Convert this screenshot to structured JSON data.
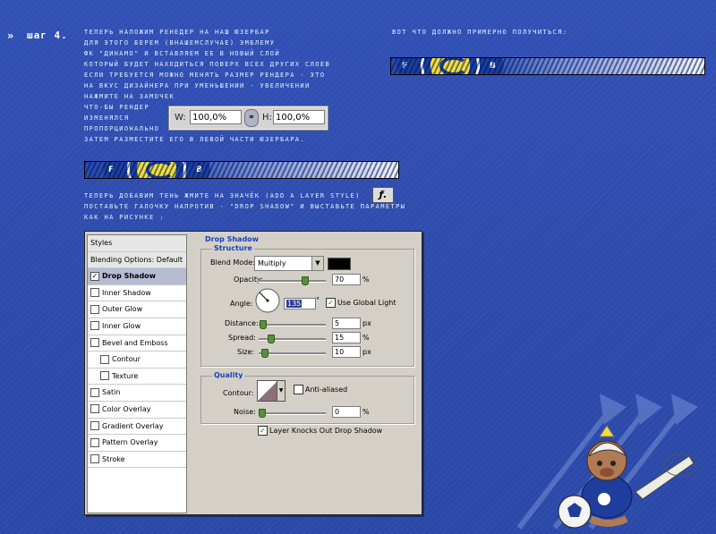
{
  "step": {
    "arrows": "»",
    "label": "шаг 4."
  },
  "text_block_1": [
    "теперь наложим ренедер на наш юзербар",
    "для этого берем (внашемслучае) эмблему",
    "фк \"динамо\" и вставляем ее в новый слой",
    "который будет находиться поверх всех других слоев",
    "если требуется можно менять размер рендера - это",
    "на вкус дизайнера при уменьшении - увеличении",
    "нажмите на замочек",
    "что-бы рендер",
    "изменялся",
    "пропорционально",
    "затем разместите его в левой части юзербара."
  ],
  "text_right": "вот что должно примерно получиться:",
  "size_panel": {
    "w_label": "W:",
    "w_value": "100,0%",
    "h_label": "H:",
    "h_value": "100,0%"
  },
  "text_block_2": [
    "теперь добавим тень жмите на значёк (add a layer style)",
    "поставьте галочку напротив - \"drop shadow\" и выставьте параметры",
    "как на рисунке :"
  ],
  "add_style_icon": "ƒ.",
  "banner_letters": {
    "left": "F",
    "right": "B"
  },
  "dialog": {
    "styles_header": "Styles",
    "blending_options": "Blending Options: Default",
    "styles": [
      {
        "label": "Drop Shadow",
        "checked": true,
        "selected": true,
        "indent": false
      },
      {
        "label": "Inner Shadow",
        "checked": false,
        "selected": false,
        "indent": false
      },
      {
        "label": "Outer Glow",
        "checked": false,
        "selected": false,
        "indent": false
      },
      {
        "label": "Inner Glow",
        "checked": false,
        "selected": false,
        "indent": false
      },
      {
        "label": "Bevel and Emboss",
        "checked": false,
        "selected": false,
        "indent": false
      },
      {
        "label": "Contour",
        "checked": false,
        "selected": false,
        "indent": true
      },
      {
        "label": "Texture",
        "checked": false,
        "selected": false,
        "indent": true
      },
      {
        "label": "Satin",
        "checked": false,
        "selected": false,
        "indent": false
      },
      {
        "label": "Color Overlay",
        "checked": false,
        "selected": false,
        "indent": false
      },
      {
        "label": "Gradient Overlay",
        "checked": false,
        "selected": false,
        "indent": false
      },
      {
        "label": "Pattern Overlay",
        "checked": false,
        "selected": false,
        "indent": false
      },
      {
        "label": "Stroke",
        "checked": false,
        "selected": false,
        "indent": false
      }
    ],
    "section_title": "Drop Shadow",
    "structure_title": "Structure",
    "blend_mode_label": "Blend Mode:",
    "blend_mode_value": "Multiply",
    "shadow_color": "#000000",
    "opacity_label": "Opacity:",
    "opacity_value": "70",
    "opacity_unit": "%",
    "angle_label": "Angle:",
    "angle_value": "135",
    "angle_unit": "°",
    "global_light_label": "Use Global Light",
    "global_light_checked": true,
    "distance_label": "Distance:",
    "distance_value": "5",
    "distance_unit": "px",
    "spread_label": "Spread:",
    "spread_value": "15",
    "spread_unit": "%",
    "size_label": "Size:",
    "size_value": "10",
    "size_unit": "px",
    "quality_title": "Quality",
    "contour_label": "Contour:",
    "anti_aliased_label": "Anti-aliased",
    "noise_label": "Noise:",
    "noise_value": "0",
    "noise_unit": "%",
    "knockout_label": "Layer Knocks Out Drop Shadow",
    "knockout_checked": true,
    "slider_levels": {
      "opacity": 0.7,
      "distance": 0.02,
      "spread": 0.15,
      "size": 0.04,
      "noise": 0.0
    }
  },
  "colors": {
    "background": "#2f4fb0",
    "accent_blue": "#1843b8",
    "logo_yellow": "#f3e03b"
  }
}
